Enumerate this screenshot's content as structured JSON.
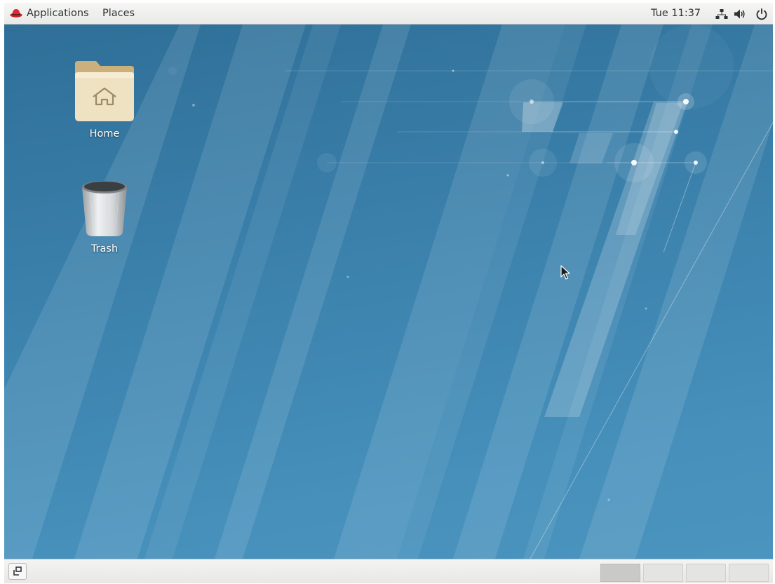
{
  "top_panel": {
    "applications_label": "Applications",
    "places_label": "Places",
    "clock": "Tue 11:37",
    "icons": [
      "redhat-icon",
      "network-icon",
      "volume-icon",
      "power-icon"
    ]
  },
  "desktop": {
    "items": [
      {
        "label": "Home",
        "icon": "home-folder-icon"
      },
      {
        "label": "Trash",
        "icon": "trash-icon"
      }
    ],
    "wallpaper_accent": "#3a80ab"
  },
  "bottom_panel": {
    "show_desktop_icon": "show-desktop-icon",
    "workspaces": [
      {
        "active": true
      },
      {
        "active": false
      },
      {
        "active": false
      },
      {
        "active": false
      }
    ]
  },
  "colors": {
    "panel_bg": "#eeeeec",
    "panel_text": "#2e3436",
    "redhat_red": "#d6272d",
    "folder_tan": "#e8d7b0"
  }
}
